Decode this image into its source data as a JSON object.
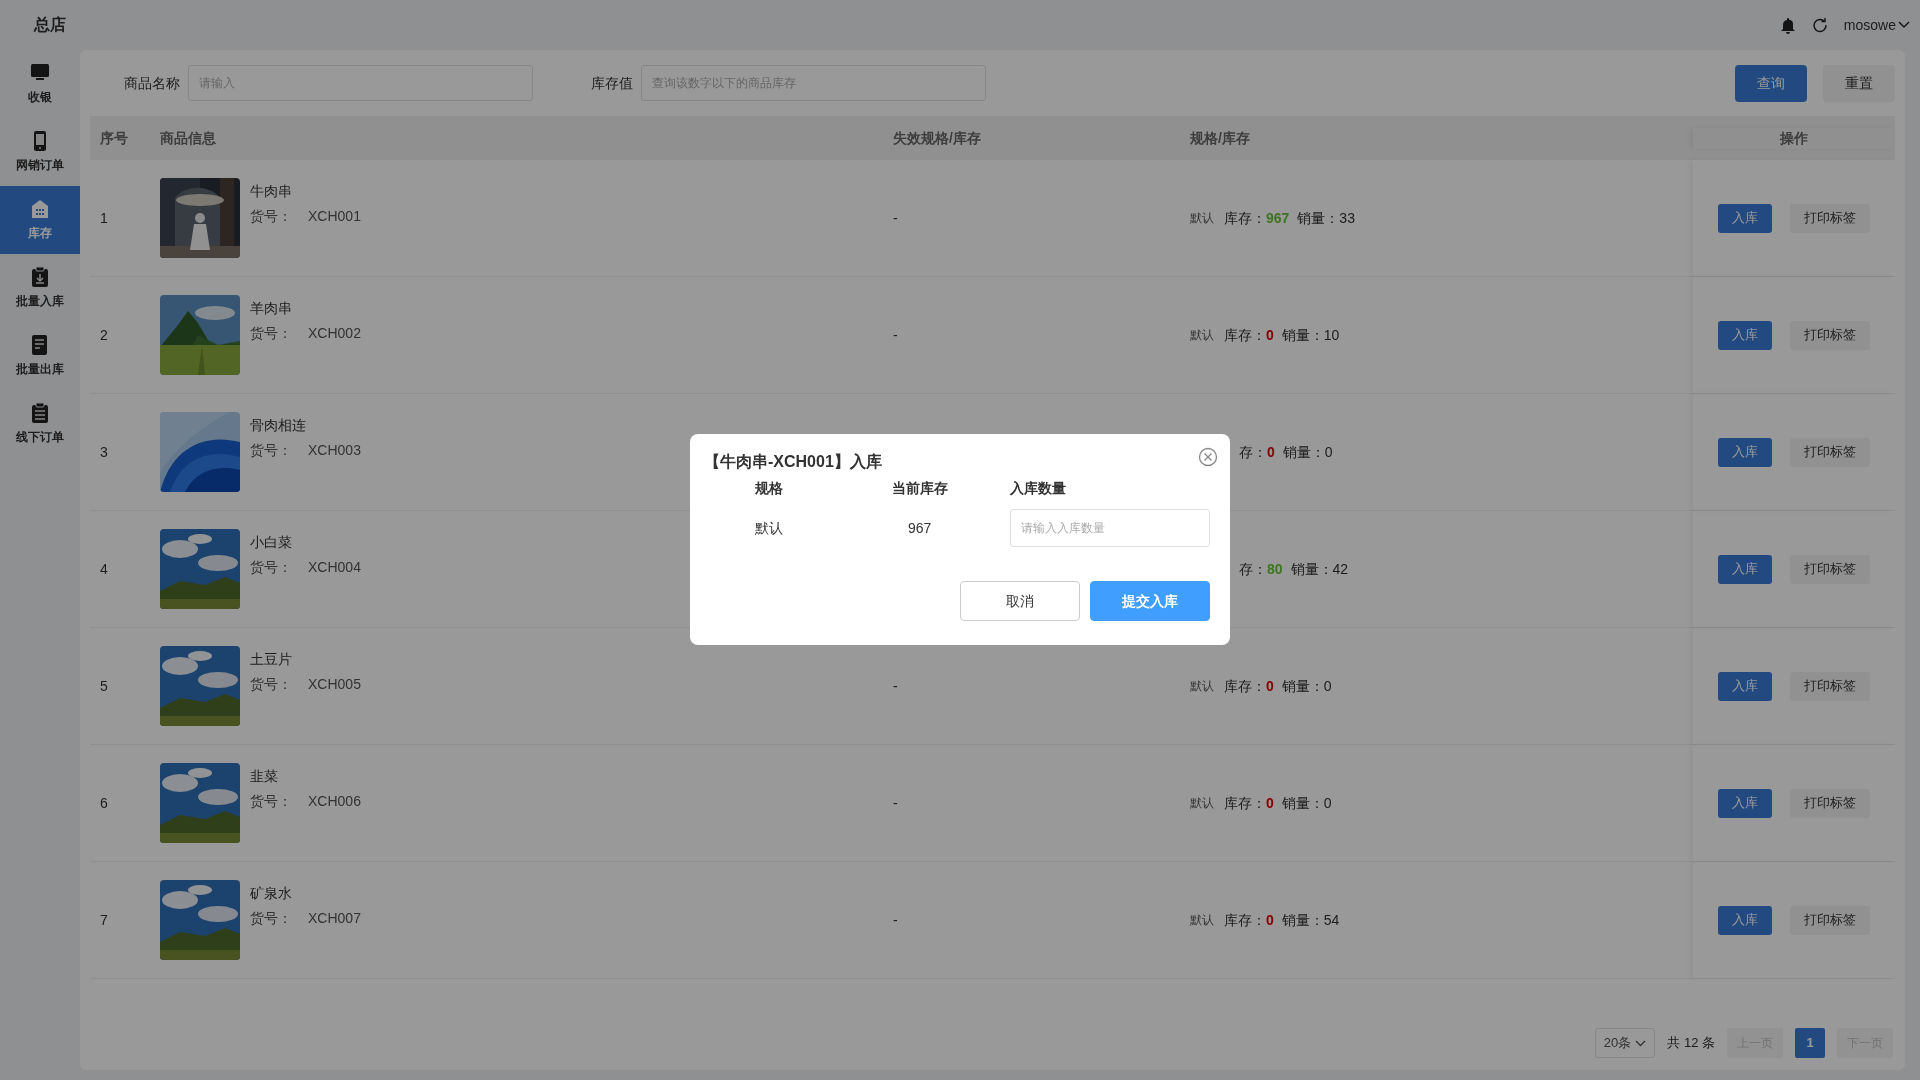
{
  "header": {
    "title": "总店",
    "user": "mosowe"
  },
  "sidebar": {
    "items": [
      {
        "label": "收银",
        "selected": false
      },
      {
        "label": "网销订单",
        "selected": false
      },
      {
        "label": "库存",
        "selected": true
      },
      {
        "label": "批量入库",
        "selected": false
      },
      {
        "label": "批量出库",
        "selected": false
      },
      {
        "label": "线下订单",
        "selected": false
      }
    ]
  },
  "search": {
    "fields": [
      {
        "label": "商品名称",
        "placeholder": "请输入"
      },
      {
        "label": "库存值",
        "placeholder": "查询该数字以下的商品库存"
      }
    ],
    "buttons": [
      {
        "label": "查询",
        "kind": "primary"
      },
      {
        "label": "重置",
        "kind": "default"
      }
    ]
  },
  "table": {
    "columns": [
      "序号",
      "商品信息",
      "失效规格/库存",
      "规格/库存",
      "操作"
    ],
    "rows": [
      {
        "index": "1",
        "picture": {
          "kind": "picture"
        },
        "name": "牛肉串",
        "sku_label": "货号：",
        "sku": "XCH001",
        "expired": "-",
        "spec": "默认",
        "stock_label": "库存：",
        "stock": "967",
        "in_stock": true,
        "sales_label": "销量：",
        "sales": "33",
        "actions": [
          "入库",
          "打印标签"
        ]
      },
      {
        "index": "2",
        "picture": {
          "kind": "picture"
        },
        "name": "羊肉串",
        "sku_label": "货号：",
        "sku": "XCH002",
        "expired": "-",
        "spec": "默认",
        "stock_label": "库存：",
        "stock": "0",
        "in_stock": false,
        "sales_label": "销量：",
        "sales": "10",
        "actions": [
          "入库",
          "打印标签"
        ]
      },
      {
        "index": "3",
        "picture": {
          "kind": "picture"
        },
        "name": "骨肉相连",
        "sku_label": "货号：",
        "sku": "XCH003",
        "stock_label": "存：",
        "stock": "0",
        "in_stock": false,
        "sales_label": "销量：",
        "sales": "0",
        "actions": [
          "入库",
          "打印标签"
        ]
      },
      {
        "index": "4",
        "picture": {
          "kind": "picture"
        },
        "name": "小白菜",
        "sku_label": "货号：",
        "sku": "XCH004",
        "stock_label": "存：",
        "stock": "80",
        "in_stock": true,
        "sales_label": "销量：",
        "sales": "42",
        "actions": [
          "入库",
          "打印标签"
        ]
      },
      {
        "index": "5",
        "picture": {
          "kind": "picture"
        },
        "name": "土豆片",
        "sku_label": "货号：",
        "sku": "XCH005",
        "expired": "-",
        "spec": "默认",
        "stock_label": "库存：",
        "stock": "0",
        "in_stock": false,
        "sales_label": "销量：",
        "sales": "0",
        "actions": [
          "入库",
          "打印标签"
        ]
      },
      {
        "index": "6",
        "picture": {
          "kind": "picture"
        },
        "name": "韭菜",
        "sku_label": "货号：",
        "sku": "XCH006",
        "expired": "-",
        "spec": "默认",
        "stock_label": "库存：",
        "stock": "0",
        "in_stock": false,
        "sales_label": "销量：",
        "sales": "0",
        "actions": [
          "入库",
          "打印标签"
        ]
      },
      {
        "index": "7",
        "picture": {
          "kind": "picture"
        },
        "name": "矿泉水",
        "sku_label": "货号：",
        "sku": "XCH007",
        "expired": "-",
        "spec": "默认",
        "stock_label": "库存：",
        "stock": "0",
        "in_stock": false,
        "sales_label": "销量：",
        "sales": "54",
        "actions": [
          "入库",
          "打印标签"
        ]
      }
    ]
  },
  "pagination": {
    "page_size": "20条",
    "total": "共 12 条",
    "prev": {
      "label": "上一页",
      "disabled": true
    },
    "pages": [
      {
        "label": "1",
        "selected": true
      }
    ],
    "next": {
      "label": "下一页",
      "disabled": true
    }
  },
  "dialog": {
    "title": "【牛肉串-XCH001】入库",
    "columns": [
      "规格",
      "当前库存",
      "入库数量"
    ],
    "row": {
      "spec": "默认",
      "stock": "967",
      "placeholder": "请输入入库数量"
    },
    "buttons": [
      {
        "label": "取消",
        "kind": "default"
      },
      {
        "label": "提交入库",
        "kind": "primary"
      }
    ]
  }
}
